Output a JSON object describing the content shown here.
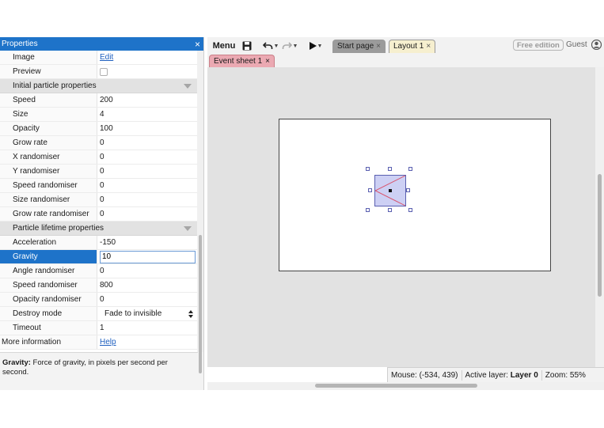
{
  "properties": {
    "title": "Properties",
    "close": "×",
    "rows_top": [
      {
        "name": "Image",
        "value": "Edit",
        "kind": "link"
      },
      {
        "name": "Preview",
        "value": "",
        "kind": "checkbox"
      }
    ],
    "section_initial": "Initial particle properties",
    "rows_initial": [
      {
        "name": "Speed",
        "value": "200"
      },
      {
        "name": "Size",
        "value": "4"
      },
      {
        "name": "Opacity",
        "value": "100"
      },
      {
        "name": "Grow rate",
        "value": "0"
      },
      {
        "name": "X randomiser",
        "value": "0"
      },
      {
        "name": "Y randomiser",
        "value": "0"
      },
      {
        "name": "Speed randomiser",
        "value": "0"
      },
      {
        "name": "Size randomiser",
        "value": "0"
      },
      {
        "name": "Grow rate randomiser",
        "value": "0"
      }
    ],
    "section_lifetime": "Particle lifetime properties",
    "rows_lifetime": [
      {
        "name": "Acceleration",
        "value": "-150"
      },
      {
        "name": "Gravity",
        "value": "10"
      },
      {
        "name": "Angle randomiser",
        "value": "0"
      },
      {
        "name": "Speed randomiser",
        "value": "800"
      },
      {
        "name": "Opacity randomiser",
        "value": "0"
      },
      {
        "name": "Destroy mode",
        "value": "Fade to invisible"
      },
      {
        "name": "Timeout",
        "value": "1"
      }
    ],
    "more_info": {
      "name": "More information",
      "value": "Help"
    },
    "description": {
      "term": "Gravity:",
      "text": " Force of gravity, in pixels per second per second."
    }
  },
  "toolbar": {
    "menu_label": "Menu",
    "tabs": [
      {
        "label": "Start page",
        "close": "×"
      },
      {
        "label": "Layout 1",
        "close": "×"
      }
    ],
    "free_edition": "Free edition",
    "user": "Guest"
  },
  "subtabs": [
    {
      "label": "Event sheet 1",
      "close": "×"
    }
  ],
  "statusbar": {
    "mouse": "Mouse: (-534, 439)",
    "active_layer_label": "Active layer:",
    "active_layer_value": "Layer 0",
    "zoom": "Zoom: 55%"
  },
  "icons": {
    "save": "floppy-disk-icon",
    "undo": "undo-icon",
    "redo": "redo-icon",
    "play": "play-icon",
    "user": "user-icon"
  },
  "colors": {
    "accent": "#1e73c9",
    "event_tab": "#eba9b2",
    "active_tab": "#f6efcf"
  }
}
